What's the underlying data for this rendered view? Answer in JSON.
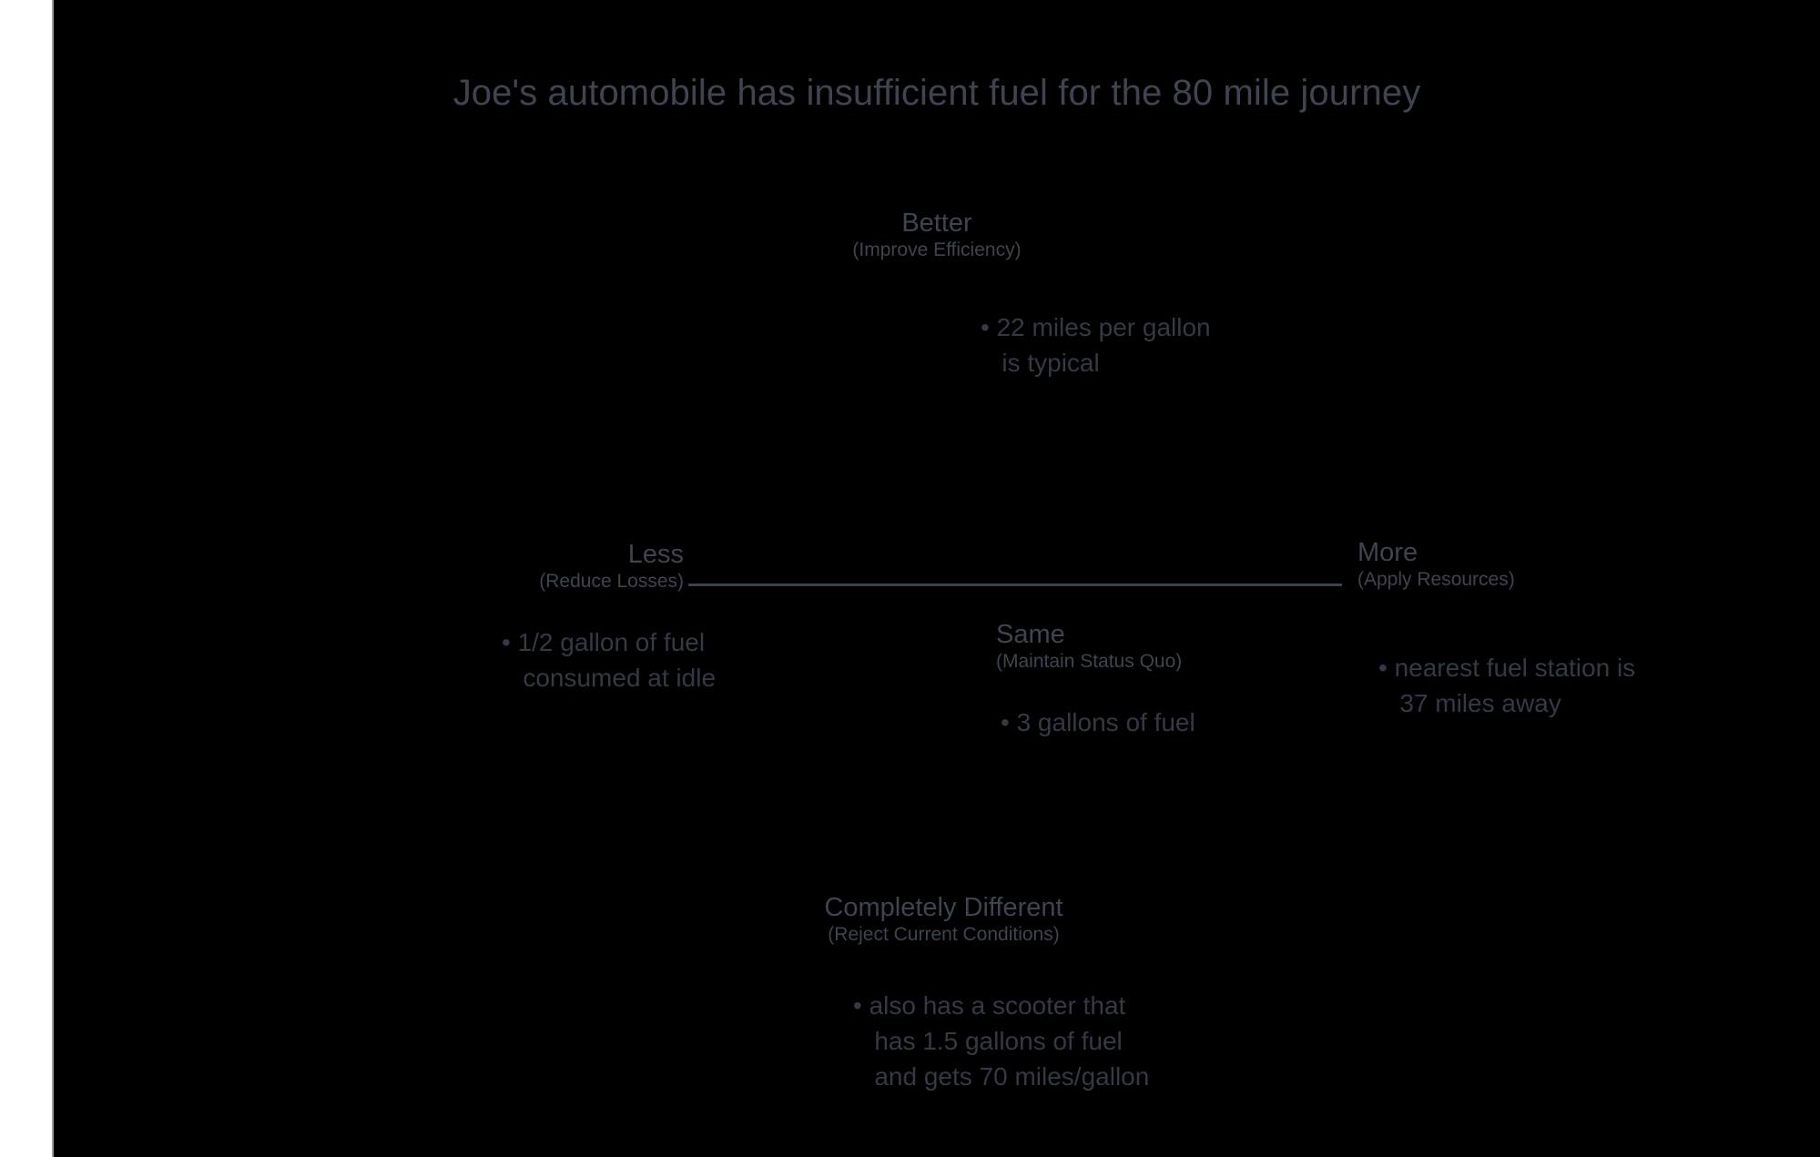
{
  "title": "Joe's automobile has insufficient fuel for the 80 mile journey",
  "colors": {
    "background": "#000000",
    "margin": "#ffffff",
    "text": "#3e4550",
    "bullet_text": "#343a45",
    "axis": "#3a4150",
    "margin_rule": "#9a9a9a"
  },
  "quadrants": {
    "top": {
      "title": "Better",
      "subtitle": "(Improve Efficiency)",
      "bullets": [
        "• 22 miles per gallon\n   is typical"
      ]
    },
    "left": {
      "title": "Less",
      "subtitle": "(Reduce Losses)",
      "bullets": [
        "• 1/2 gallon of fuel\n   consumed at idle"
      ]
    },
    "right": {
      "title": "More",
      "subtitle": "(Apply Resources)",
      "bullets": [
        "• nearest fuel station is\n   37 miles away"
      ]
    },
    "center": {
      "title": "Same",
      "subtitle": "(Maintain Status Quo)",
      "bullets": [
        "• 3 gallons of fuel"
      ]
    },
    "bottom": {
      "title": "Completely Different",
      "subtitle": "(Reject Current Conditions)",
      "bullets": [
        "• also has a scooter that\n   has 1.5 gallons of fuel\n   and gets 70 miles/gallon"
      ]
    }
  }
}
